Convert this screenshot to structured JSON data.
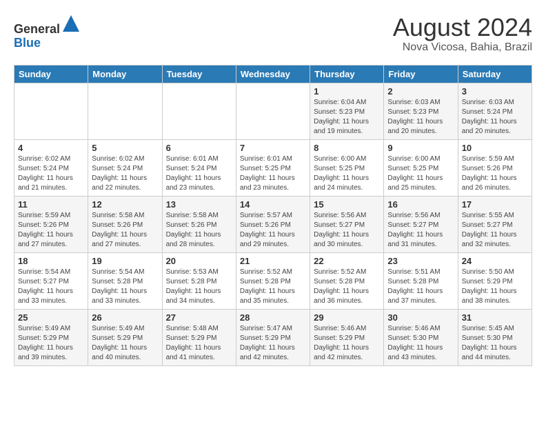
{
  "header": {
    "logo_line1": "General",
    "logo_line2": "Blue",
    "month_year": "August 2024",
    "location": "Nova Vicosa, Bahia, Brazil"
  },
  "days_of_week": [
    "Sunday",
    "Monday",
    "Tuesday",
    "Wednesday",
    "Thursday",
    "Friday",
    "Saturday"
  ],
  "weeks": [
    [
      {
        "day": "",
        "info": ""
      },
      {
        "day": "",
        "info": ""
      },
      {
        "day": "",
        "info": ""
      },
      {
        "day": "",
        "info": ""
      },
      {
        "day": "1",
        "info": "Sunrise: 6:04 AM\nSunset: 5:23 PM\nDaylight: 11 hours and 19 minutes."
      },
      {
        "day": "2",
        "info": "Sunrise: 6:03 AM\nSunset: 5:23 PM\nDaylight: 11 hours and 20 minutes."
      },
      {
        "day": "3",
        "info": "Sunrise: 6:03 AM\nSunset: 5:24 PM\nDaylight: 11 hours and 20 minutes."
      }
    ],
    [
      {
        "day": "4",
        "info": "Sunrise: 6:02 AM\nSunset: 5:24 PM\nDaylight: 11 hours and 21 minutes."
      },
      {
        "day": "5",
        "info": "Sunrise: 6:02 AM\nSunset: 5:24 PM\nDaylight: 11 hours and 22 minutes."
      },
      {
        "day": "6",
        "info": "Sunrise: 6:01 AM\nSunset: 5:24 PM\nDaylight: 11 hours and 23 minutes."
      },
      {
        "day": "7",
        "info": "Sunrise: 6:01 AM\nSunset: 5:25 PM\nDaylight: 11 hours and 23 minutes."
      },
      {
        "day": "8",
        "info": "Sunrise: 6:00 AM\nSunset: 5:25 PM\nDaylight: 11 hours and 24 minutes."
      },
      {
        "day": "9",
        "info": "Sunrise: 6:00 AM\nSunset: 5:25 PM\nDaylight: 11 hours and 25 minutes."
      },
      {
        "day": "10",
        "info": "Sunrise: 5:59 AM\nSunset: 5:26 PM\nDaylight: 11 hours and 26 minutes."
      }
    ],
    [
      {
        "day": "11",
        "info": "Sunrise: 5:59 AM\nSunset: 5:26 PM\nDaylight: 11 hours and 27 minutes."
      },
      {
        "day": "12",
        "info": "Sunrise: 5:58 AM\nSunset: 5:26 PM\nDaylight: 11 hours and 27 minutes."
      },
      {
        "day": "13",
        "info": "Sunrise: 5:58 AM\nSunset: 5:26 PM\nDaylight: 11 hours and 28 minutes."
      },
      {
        "day": "14",
        "info": "Sunrise: 5:57 AM\nSunset: 5:26 PM\nDaylight: 11 hours and 29 minutes."
      },
      {
        "day": "15",
        "info": "Sunrise: 5:56 AM\nSunset: 5:27 PM\nDaylight: 11 hours and 30 minutes."
      },
      {
        "day": "16",
        "info": "Sunrise: 5:56 AM\nSunset: 5:27 PM\nDaylight: 11 hours and 31 minutes."
      },
      {
        "day": "17",
        "info": "Sunrise: 5:55 AM\nSunset: 5:27 PM\nDaylight: 11 hours and 32 minutes."
      }
    ],
    [
      {
        "day": "18",
        "info": "Sunrise: 5:54 AM\nSunset: 5:27 PM\nDaylight: 11 hours and 33 minutes."
      },
      {
        "day": "19",
        "info": "Sunrise: 5:54 AM\nSunset: 5:28 PM\nDaylight: 11 hours and 33 minutes."
      },
      {
        "day": "20",
        "info": "Sunrise: 5:53 AM\nSunset: 5:28 PM\nDaylight: 11 hours and 34 minutes."
      },
      {
        "day": "21",
        "info": "Sunrise: 5:52 AM\nSunset: 5:28 PM\nDaylight: 11 hours and 35 minutes."
      },
      {
        "day": "22",
        "info": "Sunrise: 5:52 AM\nSunset: 5:28 PM\nDaylight: 11 hours and 36 minutes."
      },
      {
        "day": "23",
        "info": "Sunrise: 5:51 AM\nSunset: 5:28 PM\nDaylight: 11 hours and 37 minutes."
      },
      {
        "day": "24",
        "info": "Sunrise: 5:50 AM\nSunset: 5:29 PM\nDaylight: 11 hours and 38 minutes."
      }
    ],
    [
      {
        "day": "25",
        "info": "Sunrise: 5:49 AM\nSunset: 5:29 PM\nDaylight: 11 hours and 39 minutes."
      },
      {
        "day": "26",
        "info": "Sunrise: 5:49 AM\nSunset: 5:29 PM\nDaylight: 11 hours and 40 minutes."
      },
      {
        "day": "27",
        "info": "Sunrise: 5:48 AM\nSunset: 5:29 PM\nDaylight: 11 hours and 41 minutes."
      },
      {
        "day": "28",
        "info": "Sunrise: 5:47 AM\nSunset: 5:29 PM\nDaylight: 11 hours and 42 minutes."
      },
      {
        "day": "29",
        "info": "Sunrise: 5:46 AM\nSunset: 5:29 PM\nDaylight: 11 hours and 42 minutes."
      },
      {
        "day": "30",
        "info": "Sunrise: 5:46 AM\nSunset: 5:30 PM\nDaylight: 11 hours and 43 minutes."
      },
      {
        "day": "31",
        "info": "Sunrise: 5:45 AM\nSunset: 5:30 PM\nDaylight: 11 hours and 44 minutes."
      }
    ]
  ]
}
